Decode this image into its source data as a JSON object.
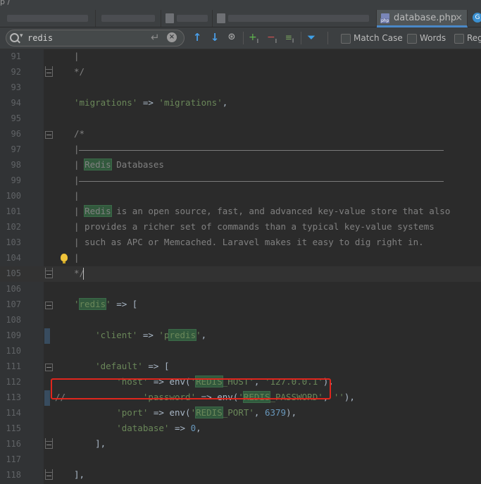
{
  "breadcrumb": "p /",
  "tabs": [
    {
      "label": ""
    },
    {
      "label": ""
    },
    {
      "label": ""
    },
    {
      "label": ""
    },
    {
      "label": "database.php",
      "close": "×"
    }
  ],
  "find": {
    "query": "redis",
    "options": {
      "match_case": "Match Case",
      "words": "Words",
      "regex": "Regex"
    }
  },
  "icons": {
    "search": "search-icon",
    "enter": "enter-icon",
    "clear": "clear-icon",
    "prev": "up-arrow-icon",
    "next": "down-arrow-icon",
    "find_all": "find-all-icon",
    "add_occ": "add-selection-icon",
    "remove_occ": "remove-selection-icon",
    "select_all": "select-all-occurrences-icon",
    "filter": "filter-icon",
    "bulb": "lightbulb-icon"
  },
  "editor": {
    "lines": [
      {
        "n": "91",
        "parts": [
          {
            "t": "|",
            "c": "c-comment"
          }
        ]
      },
      {
        "n": "92",
        "parts": [
          {
            "t": "*/",
            "c": "c-comment"
          }
        ]
      },
      {
        "n": "93",
        "parts": []
      },
      {
        "n": "94",
        "parts": [
          {
            "t": "'migrations'",
            "c": "c-str"
          },
          {
            "t": " => ",
            "c": "c-punc"
          },
          {
            "t": "'migrations'",
            "c": "c-str"
          },
          {
            "t": ",",
            "c": "c-punc"
          }
        ]
      },
      {
        "n": "95",
        "parts": []
      },
      {
        "n": "96",
        "parts": [
          {
            "t": "/*",
            "c": "c-comment"
          }
        ]
      },
      {
        "n": "97",
        "parts": [
          {
            "t": "|",
            "c": "c-comment"
          }
        ]
      },
      {
        "n": "98",
        "parts": [
          {
            "t": "| ",
            "c": "c-comment"
          },
          {
            "t": "Redis",
            "c": "c-comment",
            "hl": true
          },
          {
            "t": " Databases",
            "c": "c-comment"
          }
        ]
      },
      {
        "n": "99",
        "parts": [
          {
            "t": "|",
            "c": "c-comment"
          }
        ]
      },
      {
        "n": "100",
        "parts": [
          {
            "t": "|",
            "c": "c-comment"
          }
        ]
      },
      {
        "n": "101",
        "parts": [
          {
            "t": "| ",
            "c": "c-comment"
          },
          {
            "t": "Redis",
            "c": "c-comment",
            "hl": true
          },
          {
            "t": " is an open source, fast, and advanced key-value store that also",
            "c": "c-comment"
          }
        ]
      },
      {
        "n": "102",
        "parts": [
          {
            "t": "| provides a richer set of commands than a typical key-value systems",
            "c": "c-comment"
          }
        ]
      },
      {
        "n": "103",
        "parts": [
          {
            "t": "| such as APC or Memcached. Laravel makes it easy to dig right in.",
            "c": "c-comment"
          }
        ]
      },
      {
        "n": "104",
        "parts": [
          {
            "t": "|",
            "c": "c-comment"
          }
        ]
      },
      {
        "n": "105",
        "parts": [
          {
            "t": "*/",
            "c": "c-comment"
          }
        ]
      },
      {
        "n": "106",
        "parts": []
      },
      {
        "n": "107",
        "parts": [
          {
            "t": "'",
            "c": "c-str"
          },
          {
            "t": "redis",
            "c": "c-str",
            "hl": true
          },
          {
            "t": "'",
            "c": "c-str"
          },
          {
            "t": " => [",
            "c": "c-punc"
          }
        ]
      },
      {
        "n": "108",
        "parts": []
      },
      {
        "n": "109",
        "parts": [
          {
            "t": "    'client'",
            "c": "c-str"
          },
          {
            "t": " => ",
            "c": "c-punc"
          },
          {
            "t": "'p",
            "c": "c-str"
          },
          {
            "t": "redis",
            "c": "c-str",
            "hl": true
          },
          {
            "t": "'",
            "c": "c-str"
          },
          {
            "t": ",",
            "c": "c-punc"
          }
        ]
      },
      {
        "n": "110",
        "parts": []
      },
      {
        "n": "111",
        "parts": [
          {
            "t": "    'default'",
            "c": "c-str"
          },
          {
            "t": " => [",
            "c": "c-punc"
          }
        ]
      },
      {
        "n": "112",
        "parts": [
          {
            "t": "        'host'",
            "c": "c-str"
          },
          {
            "t": " => env(",
            "c": "c-punc"
          },
          {
            "t": "'",
            "c": "c-str"
          },
          {
            "t": "REDIS",
            "c": "c-str",
            "hl": true
          },
          {
            "t": "_HOST'",
            "c": "c-str"
          },
          {
            "t": ", ",
            "c": "c-punc"
          },
          {
            "t": "'127.0.0.1'",
            "c": "c-str"
          },
          {
            "t": "),",
            "c": "c-punc"
          }
        ]
      },
      {
        "n": "113",
        "parts": [
          {
            "t": "//",
            "c": "c-comment",
            "abs": true
          },
          {
            "t": "          'password'",
            "c": "c-str"
          },
          {
            "t": " => env(",
            "c": "c-punc"
          },
          {
            "t": "'",
            "c": "c-str"
          },
          {
            "t": "REDIS",
            "c": "c-str",
            "hl": true
          },
          {
            "t": "_PASSWORD'",
            "c": "c-str"
          },
          {
            "t": ", ",
            "c": "c-punc"
          },
          {
            "t": "''",
            "c": "c-str"
          },
          {
            "t": "),",
            "c": "c-punc"
          }
        ]
      },
      {
        "n": "114",
        "parts": [
          {
            "t": "        'port'",
            "c": "c-str"
          },
          {
            "t": " => env(",
            "c": "c-punc"
          },
          {
            "t": "'",
            "c": "c-str"
          },
          {
            "t": "REDIS",
            "c": "c-str",
            "hl": true
          },
          {
            "t": "_PORT'",
            "c": "c-str"
          },
          {
            "t": ", ",
            "c": "c-punc"
          },
          {
            "t": "6379",
            "c": "c-num"
          },
          {
            "t": "),",
            "c": "c-punc"
          }
        ]
      },
      {
        "n": "115",
        "parts": [
          {
            "t": "        'database'",
            "c": "c-str"
          },
          {
            "t": " => ",
            "c": "c-punc"
          },
          {
            "t": "0",
            "c": "c-num"
          },
          {
            "t": ",",
            "c": "c-punc"
          }
        ]
      },
      {
        "n": "116",
        "parts": [
          {
            "t": "    ],",
            "c": "c-punc"
          }
        ]
      },
      {
        "n": "117",
        "parts": []
      },
      {
        "n": "118",
        "parts": [
          {
            "t": "],",
            "c": "c-punc"
          }
        ]
      }
    ]
  }
}
